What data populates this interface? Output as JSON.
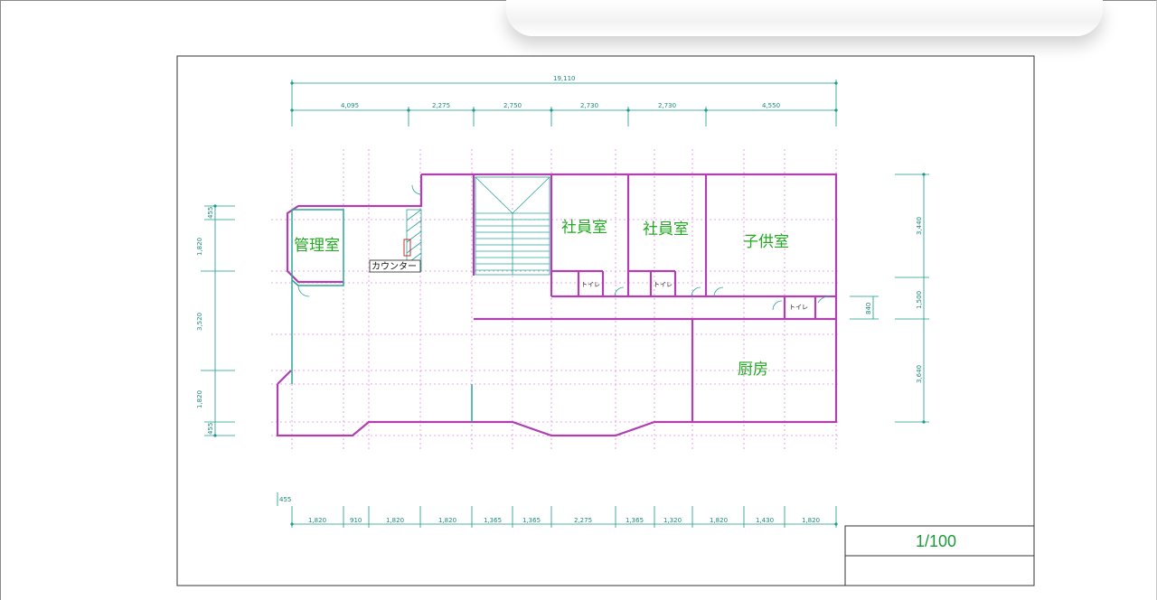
{
  "scale": "1/100",
  "rooms": {
    "office": "管理室",
    "staff1": "社員室",
    "staff2": "社員室",
    "kids": "子供室",
    "kitchen": "厨房",
    "counter": "カウンター",
    "toilet1": "トイレ",
    "toilet2": "トイレ",
    "toilet3": "トイレ"
  },
  "dims": {
    "top_total": "19,110",
    "top": [
      "4,095",
      "2,275",
      "2,750",
      "2,730",
      "2,730",
      "4,550"
    ],
    "bottom_small": "455",
    "bottom": [
      "1,820",
      "910",
      "1,820",
      "1,820",
      "1,365",
      "1,365",
      "2,275",
      "1,365",
      "1,320",
      "1,820",
      "1,430",
      "1,820"
    ],
    "left": [
      "455",
      "1,820",
      "3,520",
      "1,820",
      "455"
    ],
    "right": [
      "3,440",
      "1,500",
      "3,640"
    ],
    "right_small": "840"
  },
  "colors": {
    "wall": "#b040b0",
    "dim": "#1a9a8a",
    "grid": "#e080e0",
    "room_text": "#22aa22"
  }
}
